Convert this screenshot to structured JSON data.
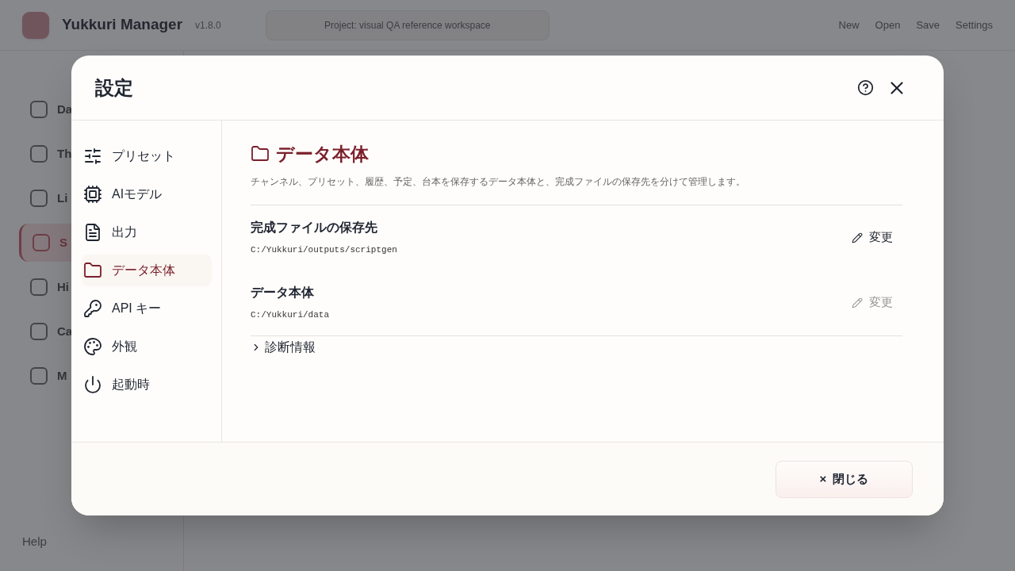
{
  "app": {
    "title": "Yukkuri Manager",
    "version": "v1.8.0",
    "project": "Project: visual QA reference workspace",
    "menu": [
      "New",
      "Open",
      "Save",
      "Settings"
    ]
  },
  "sidebar": {
    "items": [
      {
        "label": "Da",
        "selected": false
      },
      {
        "label": "Th",
        "selected": false
      },
      {
        "label": "Li",
        "selected": false
      },
      {
        "label": "S",
        "selected": true
      },
      {
        "label": "Hi",
        "selected": false
      },
      {
        "label": "Ca",
        "selected": false
      },
      {
        "label": "M",
        "selected": false
      }
    ],
    "help": "Help"
  },
  "dialog": {
    "title": "設定",
    "nav": [
      {
        "label": "プリセット",
        "kind": "sliders",
        "selected": false
      },
      {
        "label": "AIモデル",
        "kind": "chip",
        "selected": false
      },
      {
        "label": "出力",
        "kind": "file",
        "selected": false
      },
      {
        "label": "データ本体",
        "kind": "folder",
        "selected": true
      },
      {
        "label": "API キー",
        "kind": "key",
        "selected": false
      },
      {
        "label": "外観",
        "kind": "palette",
        "selected": false
      },
      {
        "label": "起動時",
        "kind": "power",
        "selected": false
      }
    ],
    "section": {
      "title": "データ本体",
      "description": "チャンネル、プリセット、履歴、予定、台本を保存するデータ本体と、完成ファイルの保存先を分けて管理します。",
      "settings": [
        {
          "label": "完成ファイルの保存先",
          "path": "C:/Yukkuri/outputs/scriptgen",
          "action": "変更",
          "disabled": false
        },
        {
          "label": "データ本体",
          "path": "C:/Yukkuri/data",
          "action": "変更",
          "disabled": true
        }
      ],
      "diagnostics": {
        "label": "診断情報",
        "expanded": false
      }
    },
    "close_mark": "×",
    "close_button": "閉じる"
  }
}
